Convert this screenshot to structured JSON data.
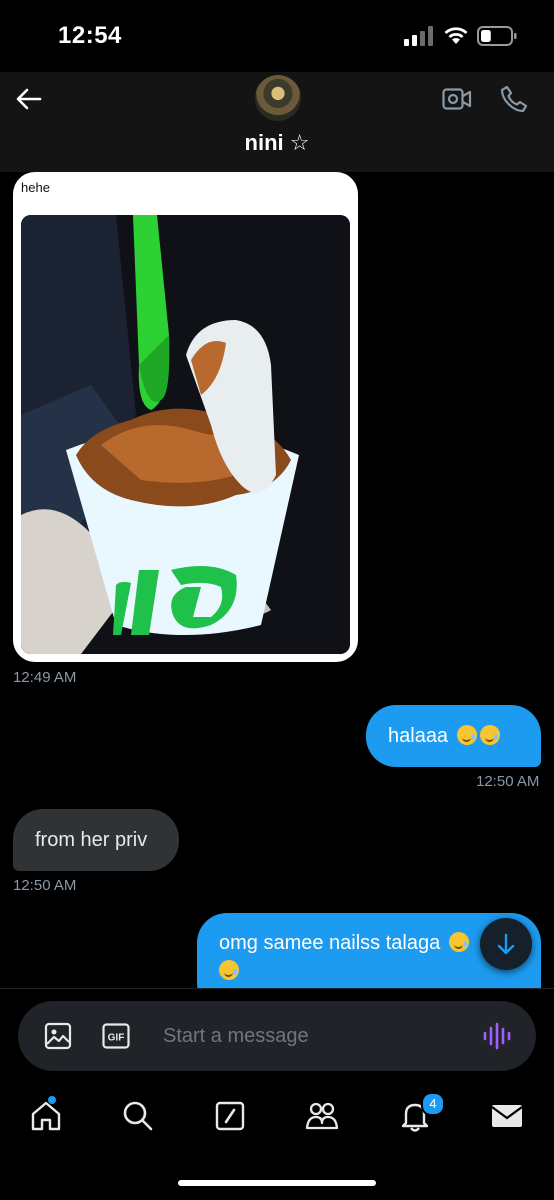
{
  "status_bar": {
    "time": "12:54",
    "battery_level": 0.35
  },
  "header": {
    "contact_name": "nini ☆"
  },
  "messages": [
    {
      "direction": "in",
      "type": "media",
      "caption": "hehe",
      "timestamp": "12:49 AM"
    },
    {
      "direction": "out",
      "text": "halaaa",
      "emoji": [
        "🥲",
        "🥲"
      ],
      "timestamp": "12:50 AM"
    },
    {
      "direction": "in",
      "text": "from her priv",
      "timestamp": "12:50 AM"
    },
    {
      "direction": "out",
      "text": "omg samee nailss talaga",
      "emoji": [
        "🥲",
        "🥲"
      ]
    }
  ],
  "composer": {
    "placeholder": "Start a message",
    "gif_label": "GIF"
  },
  "tabs": [
    {
      "icon": "home-icon",
      "has_dot": true
    },
    {
      "icon": "search-icon"
    },
    {
      "icon": "compose-icon"
    },
    {
      "icon": "communities-icon"
    },
    {
      "icon": "notifications-icon",
      "badge": "4"
    },
    {
      "icon": "messages-icon",
      "active": true
    }
  ],
  "colors": {
    "accent": "#1d9bf0",
    "incoming_bubble": "#2f3336",
    "background": "#000000",
    "voice": "#a05dff"
  }
}
